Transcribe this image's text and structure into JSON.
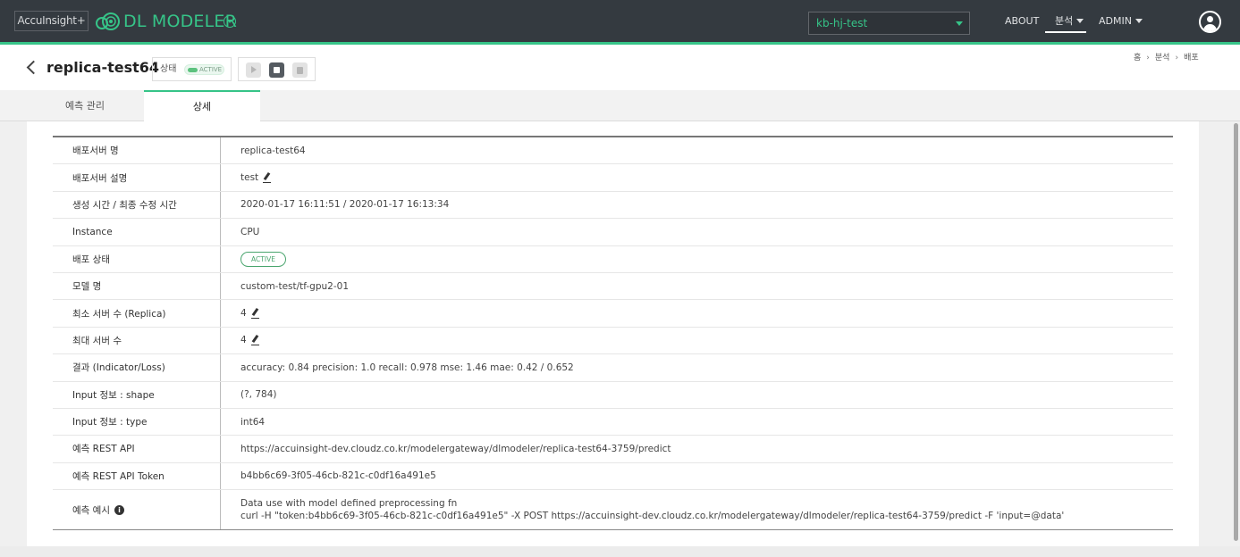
{
  "topbar": {
    "brand": "AccuInsight+",
    "app_title": "DL MODELER",
    "project": "kb-hj-test",
    "nav": {
      "about": "ABOUT",
      "analysis": "분석",
      "admin": "ADMIN"
    },
    "accent_color": "#36c488",
    "icons": [
      "logo-icon",
      "app-toggle-icon",
      "chevron-down-icon",
      "user-icon"
    ]
  },
  "header": {
    "title": "replica-test64",
    "status_label": "상태",
    "status_value": "ACTIVE",
    "actions": [
      "play-icon",
      "stop-icon",
      "delete-icon"
    ],
    "breadcrumb": [
      "홈",
      "분석",
      "배포"
    ]
  },
  "tabs": [
    {
      "label": "예측 관리",
      "active": false
    },
    {
      "label": "상세",
      "active": true
    }
  ],
  "details": [
    {
      "label": "배포서버 명",
      "value": "replica-test64"
    },
    {
      "label": "배포서버 설명",
      "value": "test",
      "editable": true
    },
    {
      "label": "생성 시간 / 최종 수정 시간",
      "value": "2020-01-17 16:11:51 / 2020-01-17 16:13:34"
    },
    {
      "label": "Instance",
      "value": "CPU"
    },
    {
      "label": "배포 상태",
      "value": "ACTIVE",
      "badge": true
    },
    {
      "label": "모델 명",
      "value": "custom-test/tf-gpu2-01"
    },
    {
      "label": "최소 서버 수 (Replica)",
      "value": "4",
      "editable": true
    },
    {
      "label": "최대 서버 수",
      "value": "4",
      "editable": true
    },
    {
      "label": "결과 (Indicator/Loss)",
      "value": "accuracy: 0.84 precision: 1.0 recall: 0.978 mse: 1.46 mae: 0.42 / 0.652"
    },
    {
      "label": "Input 정보 : shape",
      "value": "(?, 784)"
    },
    {
      "label": "Input 정보 : type",
      "value": "int64"
    },
    {
      "label": "예측 REST API",
      "value": "https://accuinsight-dev.cloudz.co.kr/modelergateway/dlmodeler/replica-test64-3759/predict"
    },
    {
      "label": "예측 REST API Token",
      "value": "b4bb6c69-3f05-46cb-821c-c0df16a491e5"
    },
    {
      "label": "예측 예시",
      "info": true,
      "lines": [
        "Data use with model defined preprocessing fn",
        "curl -H \"token:b4bb6c69-3f05-46cb-821c-c0df16a491e5\" -X POST https://accuinsight-dev.cloudz.co.kr/modelergateway/dlmodeler/replica-test64-3759/predict -F 'input=@data'"
      ]
    }
  ]
}
